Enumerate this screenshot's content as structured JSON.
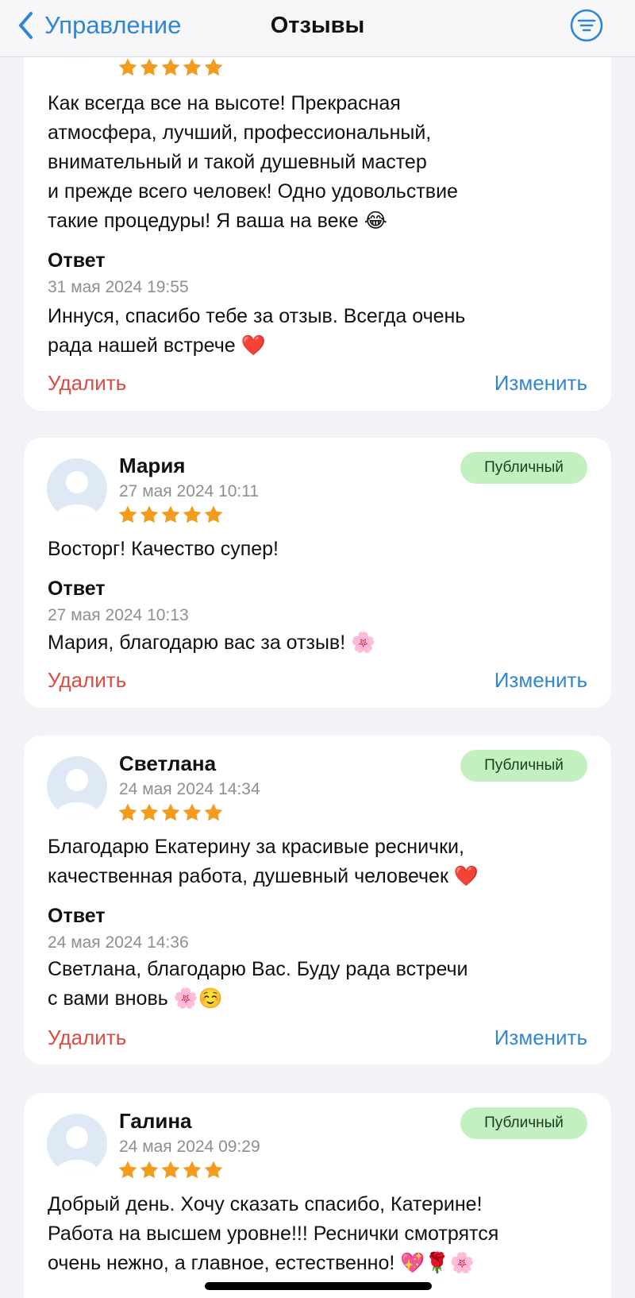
{
  "nav": {
    "back_label": "Управление",
    "title": "Отзывы",
    "filter_icon": "filter-lines-icon",
    "accent_color": "#2f86d6"
  },
  "reviews": [
    {
      "author": "",
      "date": "",
      "rating": 5,
      "text": "Как всегда все на высоте! Прекрасная\nатмосфера, лучший, профессиональный,\nвнимательный и такой душевный мастер\nи прежде всего человек! Одно удовольствие\nтакие процедуры! Я ваша на веке 😂",
      "reply_label": "Ответ",
      "reply_date": "31 мая 2024 19:55",
      "reply_text": "Иннуся, спасибо тебе за отзыв. Всегда очень\nрада нашей встрече ❤️",
      "delete_label": "Удалить",
      "edit_label": "Изменить"
    },
    {
      "author": "Мария",
      "date": "27 мая 2024 10:11",
      "rating": 5,
      "badge": "Публичный",
      "text": "Восторг! Качество супер!",
      "reply_label": "Ответ",
      "reply_date": "27 мая 2024 10:13",
      "reply_text": "Мария, благодарю вас за отзыв! 🌸",
      "delete_label": "Удалить",
      "edit_label": "Изменить"
    },
    {
      "author": "Светлана",
      "date": "24 мая 2024 14:34",
      "rating": 5,
      "badge": "Публичный",
      "text": "Благодарю  Екатерину за красивые реснички,\nкачественная работа, душевный человечек ❤️",
      "reply_label": "Ответ",
      "reply_date": "24 мая 2024 14:36",
      "reply_text": "Светлана, благодарю Вас. Буду рада встречи\nс вами вновь 🌸☺️",
      "delete_label": "Удалить",
      "edit_label": "Изменить"
    },
    {
      "author": "Галина",
      "date": "24 мая 2024 09:29",
      "rating": 5,
      "badge": "Публичный",
      "text": "Добрый день. Хочу сказать спасибо,  Катерине!\nРабота на высшем уровне!!! Реснички смотрятся\nочень нежно, а главное, естественно! 💖🌹🌸"
    }
  ],
  "colors": {
    "star": "#f29b1d",
    "delete": "#de4a3f",
    "badge_bg": "#c3f0c0",
    "page_bg": "#f2f2f7"
  }
}
